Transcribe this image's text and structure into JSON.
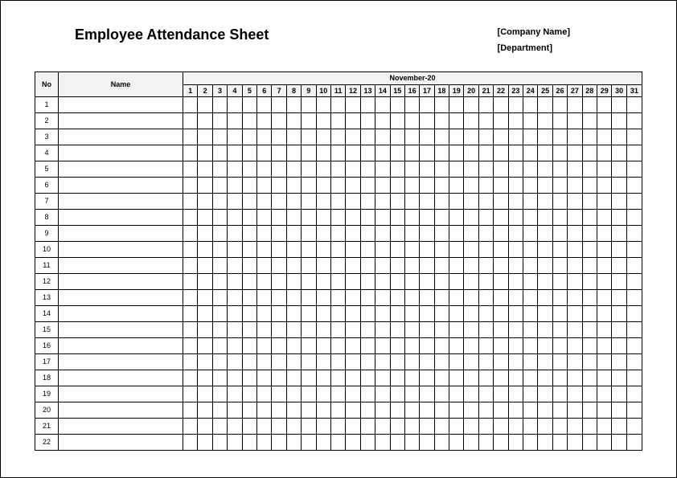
{
  "title": "Employee Attendance Sheet",
  "company_label": "[Company Name]",
  "department_label": "[Department]",
  "columns": {
    "no": "No",
    "name": "Name",
    "month": "November-20"
  },
  "days": [
    "1",
    "2",
    "3",
    "4",
    "5",
    "6",
    "7",
    "8",
    "9",
    "10",
    "11",
    "12",
    "13",
    "14",
    "15",
    "16",
    "17",
    "18",
    "19",
    "20",
    "21",
    "22",
    "23",
    "24",
    "25",
    "26",
    "27",
    "28",
    "29",
    "30",
    "31"
  ],
  "rows": [
    {
      "no": "1",
      "name": ""
    },
    {
      "no": "2",
      "name": ""
    },
    {
      "no": "3",
      "name": ""
    },
    {
      "no": "4",
      "name": ""
    },
    {
      "no": "5",
      "name": ""
    },
    {
      "no": "6",
      "name": ""
    },
    {
      "no": "7",
      "name": ""
    },
    {
      "no": "8",
      "name": ""
    },
    {
      "no": "9",
      "name": ""
    },
    {
      "no": "10",
      "name": ""
    },
    {
      "no": "11",
      "name": ""
    },
    {
      "no": "12",
      "name": ""
    },
    {
      "no": "13",
      "name": ""
    },
    {
      "no": "14",
      "name": ""
    },
    {
      "no": "15",
      "name": ""
    },
    {
      "no": "16",
      "name": ""
    },
    {
      "no": "17",
      "name": ""
    },
    {
      "no": "18",
      "name": ""
    },
    {
      "no": "19",
      "name": ""
    },
    {
      "no": "20",
      "name": ""
    },
    {
      "no": "21",
      "name": ""
    },
    {
      "no": "22",
      "name": ""
    }
  ]
}
